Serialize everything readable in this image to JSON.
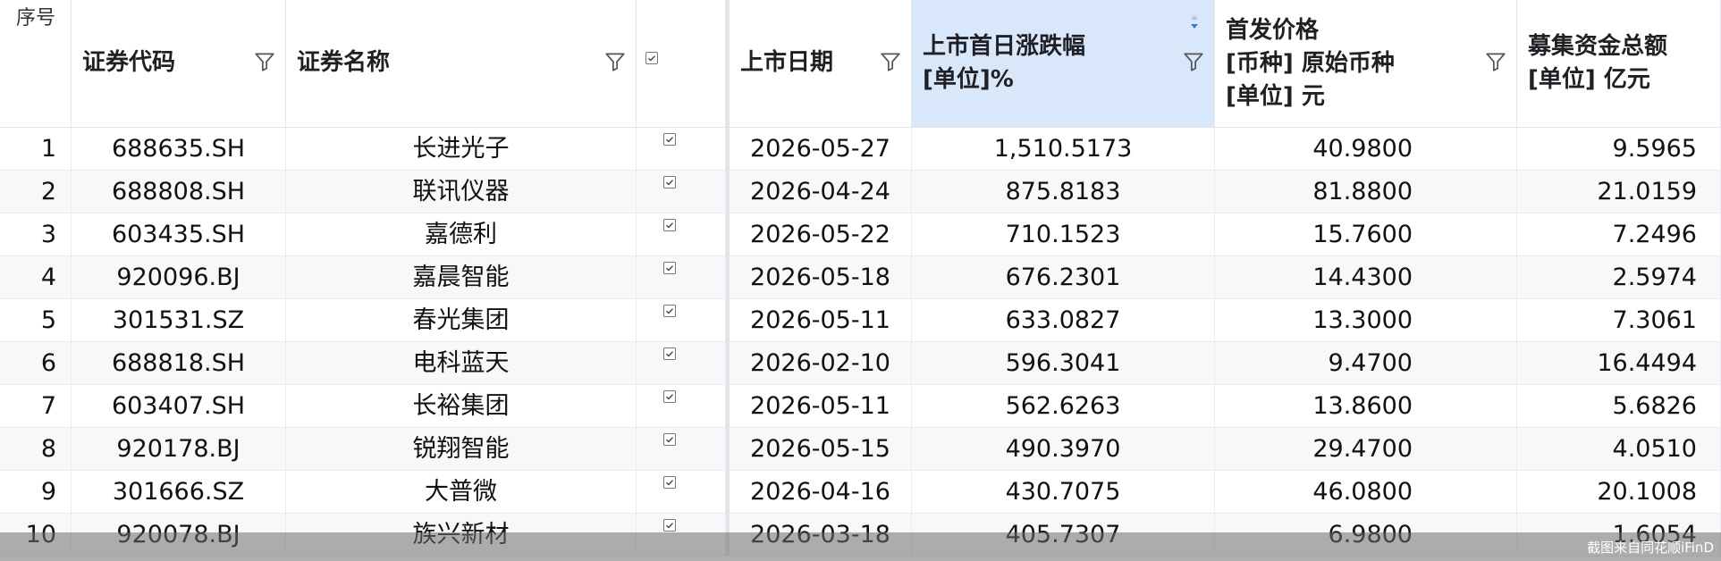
{
  "columns": {
    "seq": "序号",
    "code": "证券代码",
    "name": "证券名称",
    "date": "上市日期",
    "first_day_change": [
      "上市首日涨跌幅",
      "[单位]%"
    ],
    "ipo_price": [
      "首发价格",
      "[币种]  原始币种",
      "[单位]   元"
    ],
    "funds_raised": [
      "募集资金总额",
      "[单位]  亿元"
    ]
  },
  "rows": [
    {
      "seq": "1",
      "code": "688635.SH",
      "name": "长进光子",
      "date": "2026-05-27",
      "change": "1,510.5173",
      "price": "40.9800",
      "funds": "9.5965"
    },
    {
      "seq": "2",
      "code": "688808.SH",
      "name": "联讯仪器",
      "date": "2026-04-24",
      "change": "875.8183",
      "price": "81.8800",
      "funds": "21.0159"
    },
    {
      "seq": "3",
      "code": "603435.SH",
      "name": "嘉德利",
      "date": "2026-05-22",
      "change": "710.1523",
      "price": "15.7600",
      "funds": "7.2496"
    },
    {
      "seq": "4",
      "code": "920096.BJ",
      "name": "嘉晨智能",
      "date": "2026-05-18",
      "change": "676.2301",
      "price": "14.4300",
      "funds": "2.5974"
    },
    {
      "seq": "5",
      "code": "301531.SZ",
      "name": "春光集团",
      "date": "2026-05-11",
      "change": "633.0827",
      "price": "13.3000",
      "funds": "7.3061"
    },
    {
      "seq": "6",
      "code": "688818.SH",
      "name": "电科蓝天",
      "date": "2026-02-10",
      "change": "596.3041",
      "price": "9.4700",
      "funds": "16.4494"
    },
    {
      "seq": "7",
      "code": "603407.SH",
      "name": "长裕集团",
      "date": "2026-05-11",
      "change": "562.6263",
      "price": "13.8600",
      "funds": "5.6826"
    },
    {
      "seq": "8",
      "code": "920178.BJ",
      "name": "锐翔智能",
      "date": "2026-05-15",
      "change": "490.3970",
      "price": "29.4700",
      "funds": "4.0510"
    },
    {
      "seq": "9",
      "code": "301666.SZ",
      "name": "大普微",
      "date": "2026-04-16",
      "change": "430.7075",
      "price": "46.0800",
      "funds": "20.1008"
    },
    {
      "seq": "10",
      "code": "920078.BJ",
      "name": "族兴新材",
      "date": "2026-03-18",
      "change": "405.7307",
      "price": "6.9800",
      "funds": "1.6054"
    }
  ],
  "sort": {
    "column": "first_day_change",
    "direction": "descending"
  },
  "watermark": "截图来自同花顺iFinD",
  "colors": {
    "sorted_header": "#d9e7fb",
    "overlay": "#6e6e6e",
    "border": "#ececf0"
  },
  "icons": {
    "filter": "filter-icon",
    "checkbox": "checkbox-icon",
    "sort": "sort-descending-icon"
  }
}
